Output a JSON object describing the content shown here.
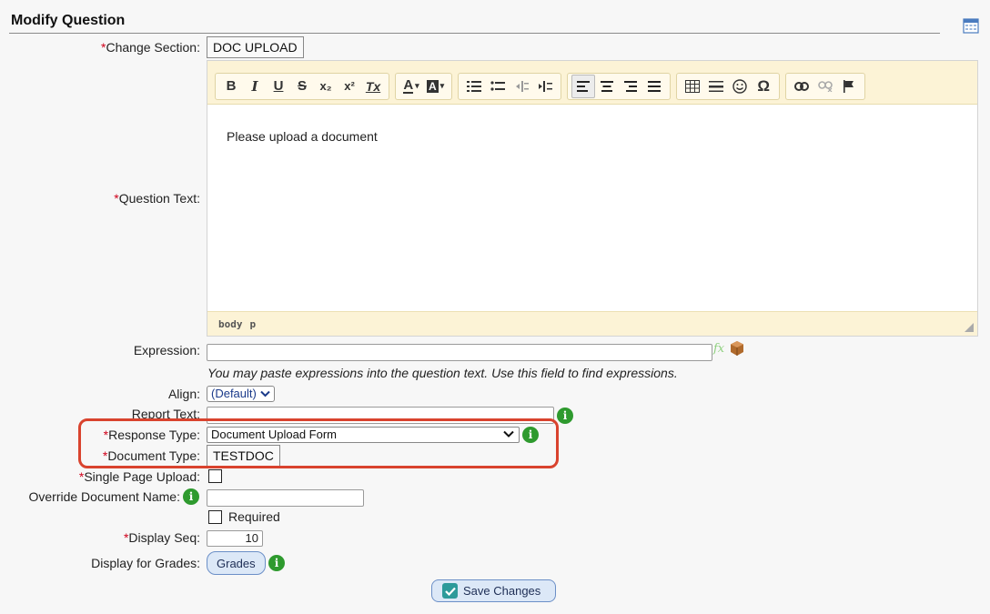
{
  "page": {
    "title": "Modify Question"
  },
  "form": {
    "change_section": {
      "label": "Change Section:",
      "value": "DOC UPLOAD"
    },
    "question_text": {
      "label": "Question Text:",
      "content": "Please upload a document",
      "path": [
        "body",
        "p"
      ]
    },
    "expression": {
      "label": "Expression:",
      "value": "",
      "hint": "You may paste expressions into the question text. Use this field to find expressions."
    },
    "align": {
      "label": "Align:",
      "value": "(Default)"
    },
    "report_text": {
      "label": "Report Text:",
      "value": ""
    },
    "response_type": {
      "label": "Response Type:",
      "value": "Document Upload Form"
    },
    "document_type": {
      "label": "Document Type:",
      "value": "TESTDOC"
    },
    "single_page_upload": {
      "label": "Single Page Upload:",
      "checked": false
    },
    "override_document_name": {
      "label": "Override Document Name:",
      "value": ""
    },
    "required": {
      "label": "Required",
      "checked": false
    },
    "display_seq": {
      "label": "Display Seq:",
      "value": "10"
    },
    "display_for_grades": {
      "label": "Display for Grades:",
      "button": "Grades"
    }
  },
  "required_marker": "*",
  "save_button": {
    "label": "Save Changes"
  },
  "toolbar": {
    "bold": "B",
    "italic": "I",
    "underline": "U",
    "strike": "S",
    "subscript": "x₂",
    "superscript": "x²",
    "clear_format": "Tx",
    "font_color": "A",
    "bg_color": "A",
    "omega": "Ω"
  },
  "colors": {
    "highlight": "#d9432e",
    "required": "#d0021b",
    "info": "#2e9a2e",
    "toolbar_bg": "#fcf3d6"
  }
}
